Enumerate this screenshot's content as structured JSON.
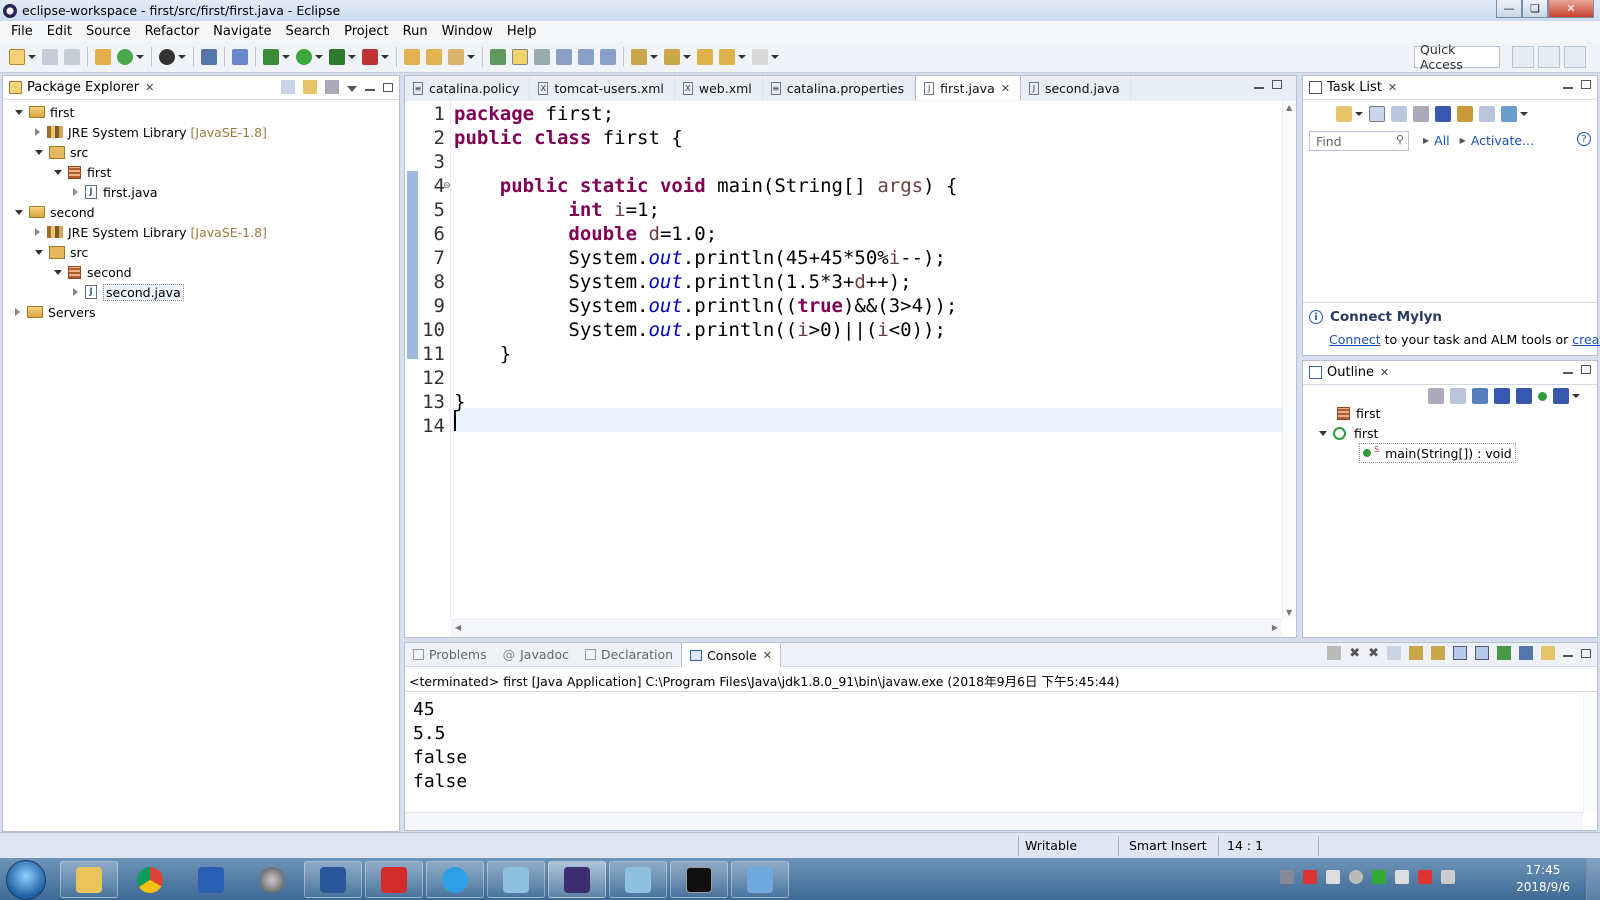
{
  "window": {
    "title": "eclipse-workspace - first/src/first/first.java - Eclipse"
  },
  "menu": [
    "File",
    "Edit",
    "Source",
    "Refactor",
    "Navigate",
    "Search",
    "Project",
    "Run",
    "Window",
    "Help"
  ],
  "toolbar": {
    "quick_access": "Quick Access"
  },
  "package_explorer": {
    "title": "Package Explorer",
    "tree": {
      "first_project": "first",
      "first_jre": "JRE System Library",
      "first_jre_ver": "[JavaSE-1.8]",
      "first_src": "src",
      "first_pkg": "first",
      "first_file": "first.java",
      "second_project": "second",
      "second_jre": "JRE System Library",
      "second_jre_ver": "[JavaSE-1.8]",
      "second_src": "src",
      "second_pkg": "second",
      "second_file": "second.java",
      "servers": "Servers"
    }
  },
  "editor": {
    "tabs": [
      "catalina.policy",
      "tomcat-users.xml",
      "web.xml",
      "catalina.properties",
      "first.java",
      "second.java"
    ],
    "active_tab": "first.java",
    "line_numbers": [
      "1",
      "2",
      "3",
      "4",
      "5",
      "6",
      "7",
      "8",
      "9",
      "10",
      "11",
      "12",
      "13",
      "14"
    ],
    "code": {
      "l1_kw": "package",
      "l1_rest": " first;",
      "l2_kw1": "public",
      "l2_kw2": "class",
      "l2_rest": " first {",
      "l4_kw1": "public",
      "l4_kw2": "static",
      "l4_kw3": "void",
      "l4_a": " main(String[] ",
      "l4_var": "args",
      "l4_b": ") {",
      "l5_kw": "int",
      "l5_var": "i",
      "l5_rest": "=1;",
      "l6_kw": "double",
      "l6_var": "d",
      "l6_rest": "=1.0;",
      "l7_a": "System.",
      "l7_out": "out",
      "l7_b": ".println(45+45*50%",
      "l7_var": "i",
      "l7_c": "--);",
      "l8_a": "System.",
      "l8_out": "out",
      "l8_b": ".println(1.5*3+",
      "l8_var": "d",
      "l8_c": "++);",
      "l9_a": "System.",
      "l9_out": "out",
      "l9_b": ".println((",
      "l9_kw": "true",
      "l9_c": ")&&(3>4));",
      "l10_a": "System.",
      "l10_out": "out",
      "l10_b": ".println((",
      "l10_var1": "i",
      "l10_c": ">0)||(",
      "l10_var2": "i",
      "l10_d": "<0));",
      "l11": "}",
      "l13": "}"
    }
  },
  "task_list": {
    "title": "Task List",
    "find_placeholder": "Find",
    "all": "All",
    "activate": "Activate...",
    "mylyn_title": "Connect Mylyn",
    "mylyn_connect": "Connect",
    "mylyn_text": " to your task and ALM tools or ",
    "mylyn_create": "create"
  },
  "outline": {
    "title": "Outline",
    "items": [
      "first",
      "first",
      "main(String[]) : void"
    ],
    "static_mark": "S"
  },
  "console": {
    "tabs": [
      "Problems",
      "Javadoc",
      "Declaration",
      "Console"
    ],
    "active_tab": "Console",
    "header": "<terminated> first [Java Application] C:\\Program Files\\Java\\jdk1.8.0_91\\bin\\javaw.exe (2018年9月6日 下午5:45:44)",
    "output": [
      "45",
      "5.5",
      "false",
      "false"
    ]
  },
  "status": {
    "writable": "Writable",
    "insert_mode": "Smart Insert",
    "position": "14 : 1"
  },
  "taskbar": {
    "time": "17:45",
    "date": "2018/9/6"
  }
}
